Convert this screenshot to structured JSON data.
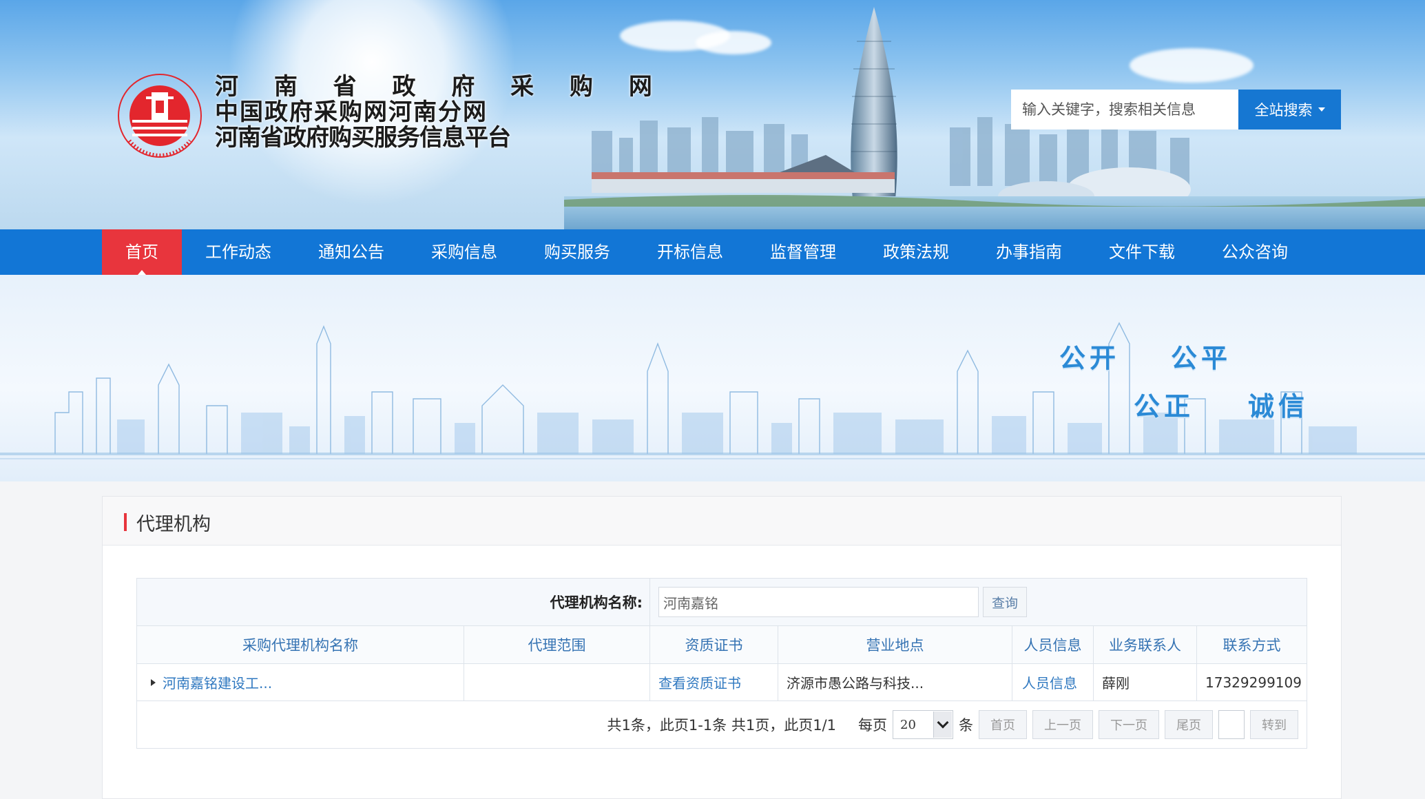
{
  "header": {
    "title_lines": [
      "河 南 省 政 府 采 购 网",
      "中国政府采购网河南分网",
      "河南省政府购买服务信息平台"
    ],
    "logo_ring_text": "HENAN GOVERNMENT PROCUREMENT",
    "search_placeholder": "输入关键字，搜索相关信息",
    "search_button": "全站搜索"
  },
  "nav": {
    "items": [
      "首页",
      "工作动态",
      "通知公告",
      "采购信息",
      "购买服务",
      "开标信息",
      "监督管理",
      "政策法规",
      "办事指南",
      "文件下载",
      "公众咨询"
    ],
    "active_index": 0
  },
  "banner": {
    "slogans": [
      "公开",
      "公平",
      "公正",
      "诚信"
    ]
  },
  "panel": {
    "title": "代理机构",
    "query": {
      "label": "代理机构名称:",
      "value": "河南嘉铭",
      "button": "查询"
    },
    "table": {
      "headers": [
        "采购代理机构名称",
        "代理范围",
        "资质证书",
        "营业地点",
        "人员信息",
        "业务联系人",
        "联系方式"
      ],
      "rows": [
        {
          "name": "河南嘉铭建设工...",
          "scope": "",
          "cert": "查看资质证书",
          "location": "济源市愚公路与科技...",
          "staff": "人员信息",
          "contact": "薛刚",
          "phone": "17329299109"
        }
      ]
    },
    "pager": {
      "info": "共1条，此页1-1条 共1页，此页1/1",
      "per_page_label": "每页",
      "per_page_value": "20",
      "unit": "条",
      "first": "首页",
      "prev": "上一页",
      "next": "下一页",
      "last": "尾页",
      "go": "转到"
    }
  },
  "colors": {
    "nav_bg": "#1276d6",
    "nav_active": "#e8353d",
    "search_btn": "#1677d2",
    "link": "#2f78c0"
  }
}
